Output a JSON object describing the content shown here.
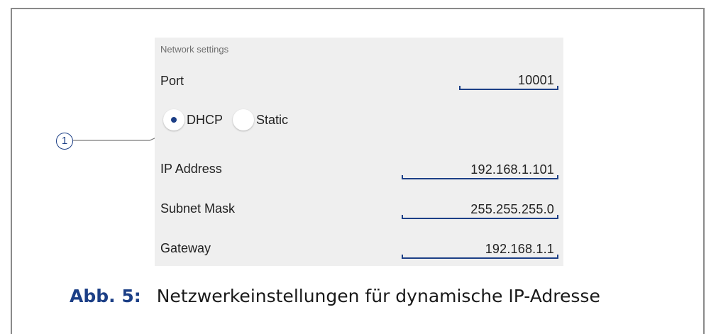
{
  "panel": {
    "title": "Network settings",
    "port": {
      "label": "Port",
      "value": "10001"
    },
    "mode": {
      "options": [
        {
          "label": "DHCP",
          "selected": true
        },
        {
          "label": "Static",
          "selected": false
        }
      ]
    },
    "ip_address": {
      "label": "IP Address",
      "value": "192.168.1.101"
    },
    "subnet_mask": {
      "label": "Subnet Mask",
      "value": "255.255.255.0"
    },
    "gateway": {
      "label": "Gateway",
      "value": "192.168.1.1"
    }
  },
  "callout": {
    "number": "1"
  },
  "caption": {
    "number": "Abb. 5:",
    "text": "Netzwerkeinstellungen für dynamische IP-Adresse"
  },
  "colors": {
    "accent": "#1c3f86",
    "panel_bg": "#efefef",
    "frame": "#8a8a8a"
  }
}
